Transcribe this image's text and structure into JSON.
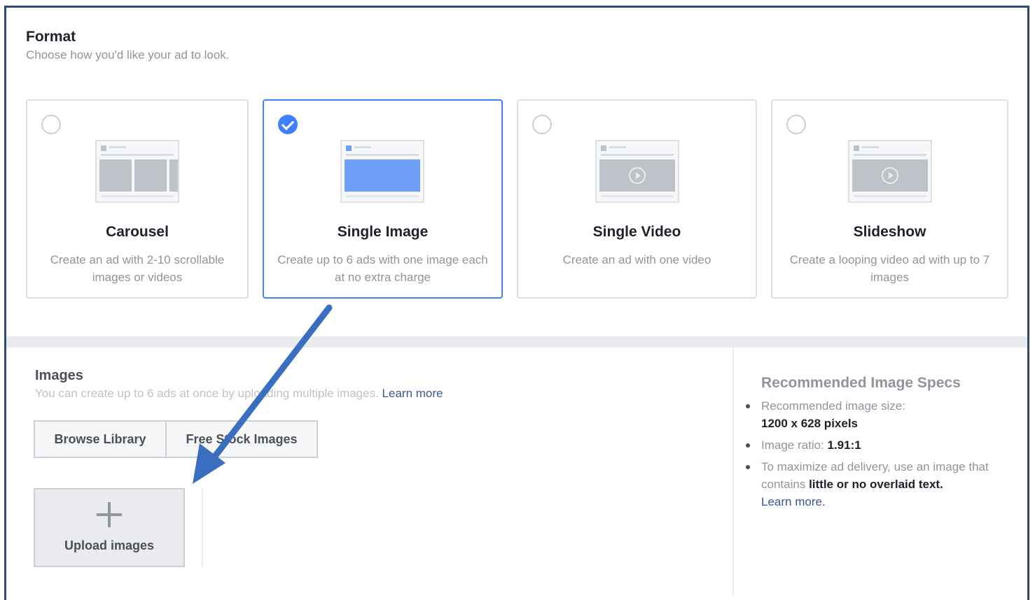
{
  "format": {
    "title": "Format",
    "subtitle": "Choose how you'd like your ad to look.",
    "cards": [
      {
        "title": "Carousel",
        "description": "Create an ad with 2-10 scrollable images or videos",
        "selected": false,
        "icon": "carousel-preview-icon"
      },
      {
        "title": "Single Image",
        "description": "Create up to 6 ads with one image each at no extra charge",
        "selected": true,
        "icon": "single-image-preview-icon"
      },
      {
        "title": "Single Video",
        "description": "Create an ad with one video",
        "selected": false,
        "icon": "video-preview-icon"
      },
      {
        "title": "Slideshow",
        "description": "Create a looping video ad with up to 7 images",
        "selected": false,
        "icon": "slideshow-preview-icon"
      }
    ]
  },
  "images": {
    "title": "Images",
    "subtitle": "You can create up to 6 ads at once by uploading multiple images.",
    "learn_more": "Learn more",
    "browse_library": "Browse Library",
    "free_stock": "Free Stock Images",
    "upload_label": "Upload images"
  },
  "specs": {
    "title": "Recommended Image Specs",
    "size_label": "Recommended image size:",
    "size_value": "1200 x 628 pixels",
    "ratio_label": "Image ratio:",
    "ratio_value": "1.91:1",
    "delivery_text": "To maximize ad delivery, use an image that contains",
    "delivery_bold": "little or no overlaid text.",
    "learn_more": "Learn more."
  },
  "colors": {
    "accent": "#4080ff",
    "frame": "#2c4a78",
    "arrow": "#3a6fc0",
    "link": "#365899"
  }
}
